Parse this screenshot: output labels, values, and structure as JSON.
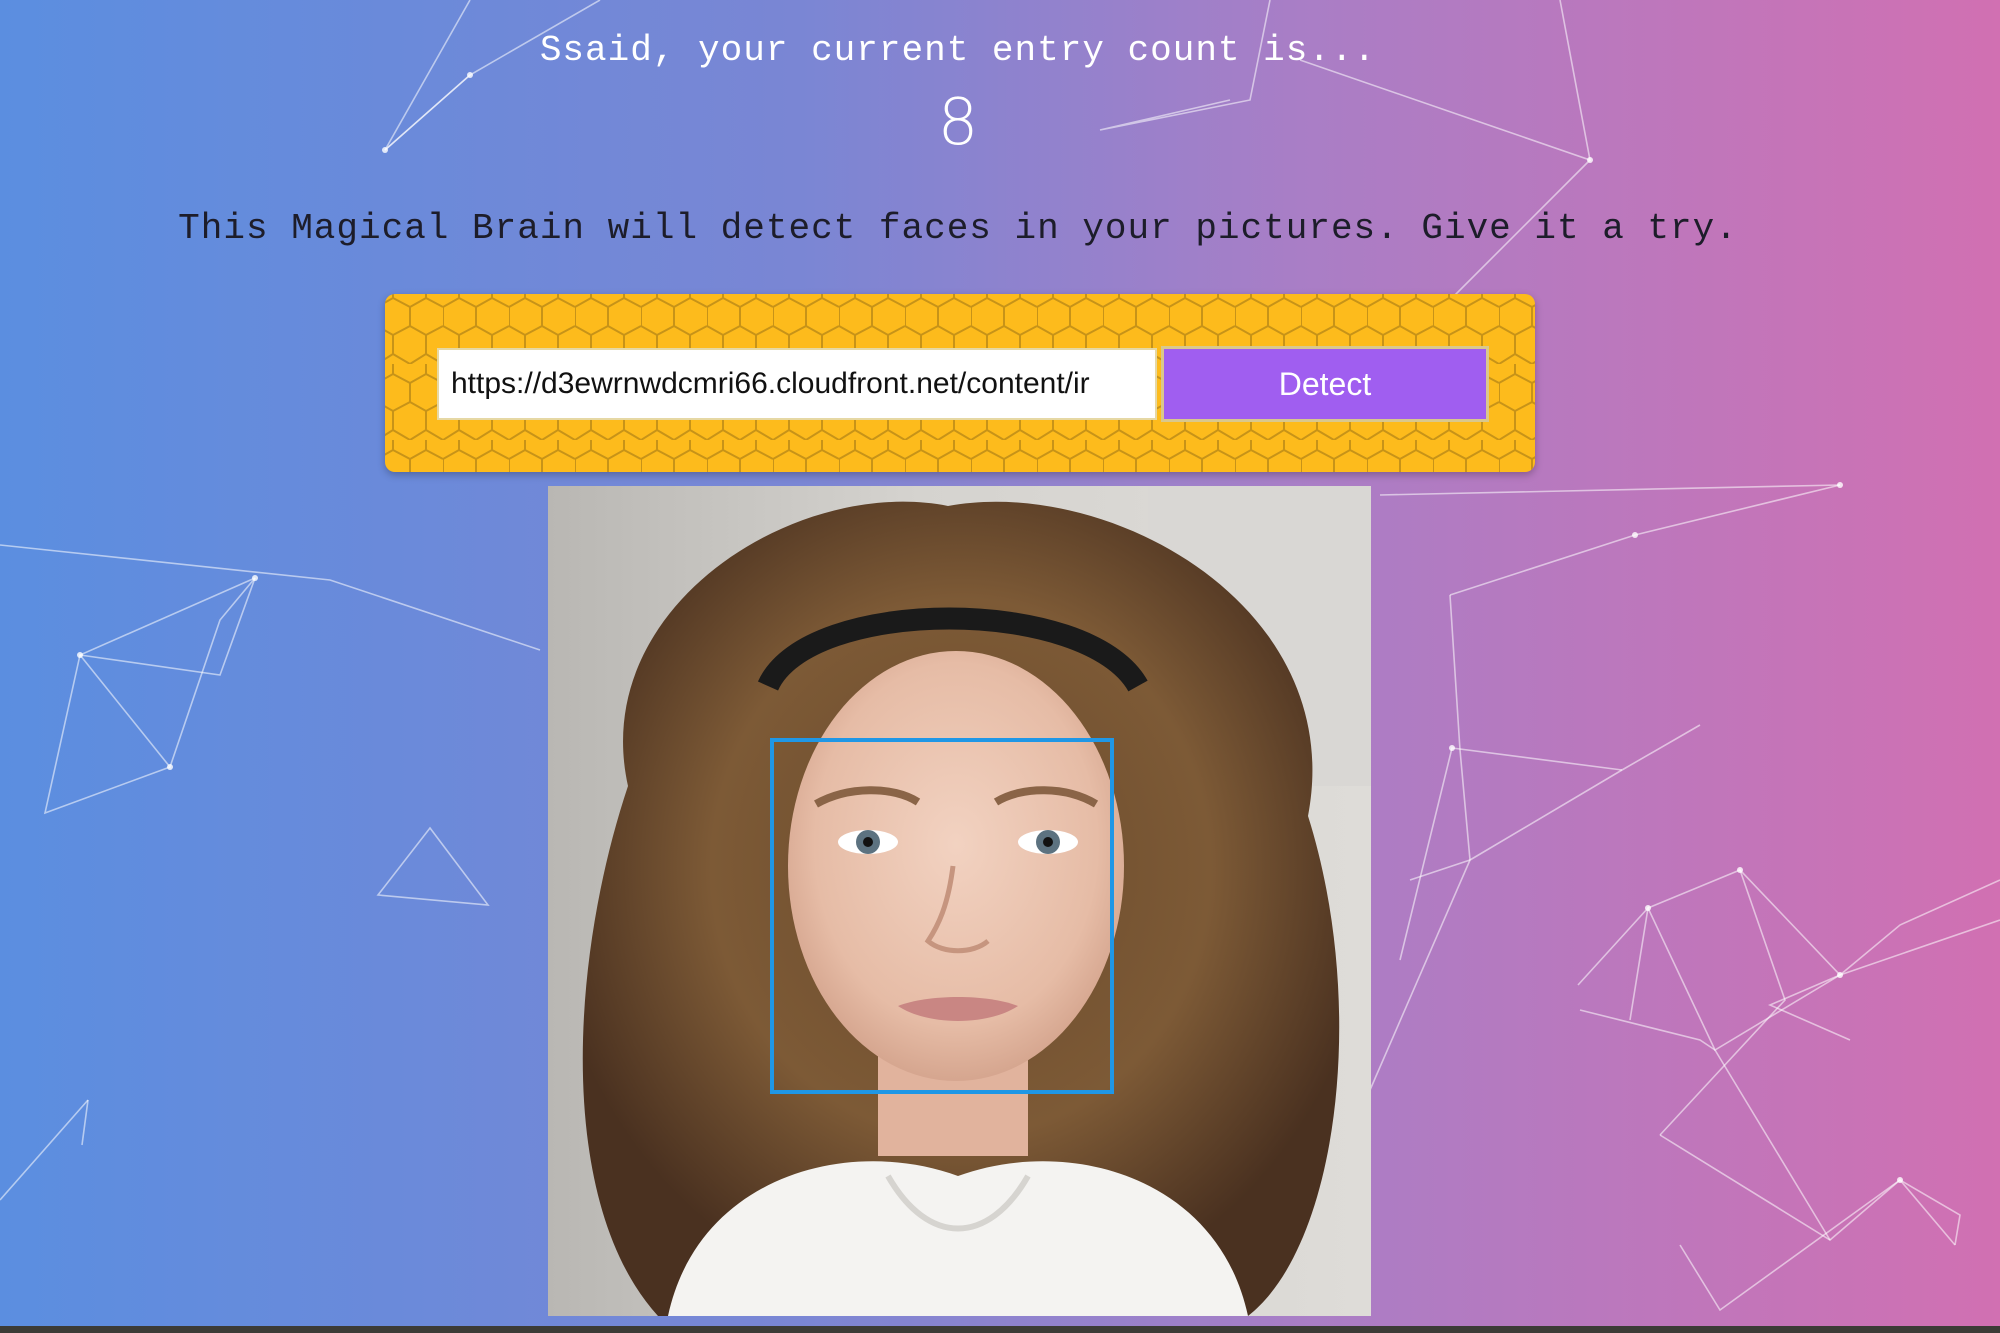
{
  "header": {
    "greeting": "Ssaid, your current entry count is...",
    "entry_count": "8"
  },
  "description": "This Magical Brain will detect faces in your pictures. Give it a try.",
  "form": {
    "url_value": "https://d3ewrnwdcmri66.cloudfront.net/content/ir",
    "detect_label": "Detect"
  },
  "colors": {
    "gradient_left": "#5b8ee0",
    "gradient_right": "#d170b2",
    "panel": "#fdbb1c",
    "button": "#a05ef0",
    "face_box": "#1f97e6"
  },
  "icons": {
    "background": "particle-network",
    "panel_pattern": "honeycomb-pattern"
  }
}
